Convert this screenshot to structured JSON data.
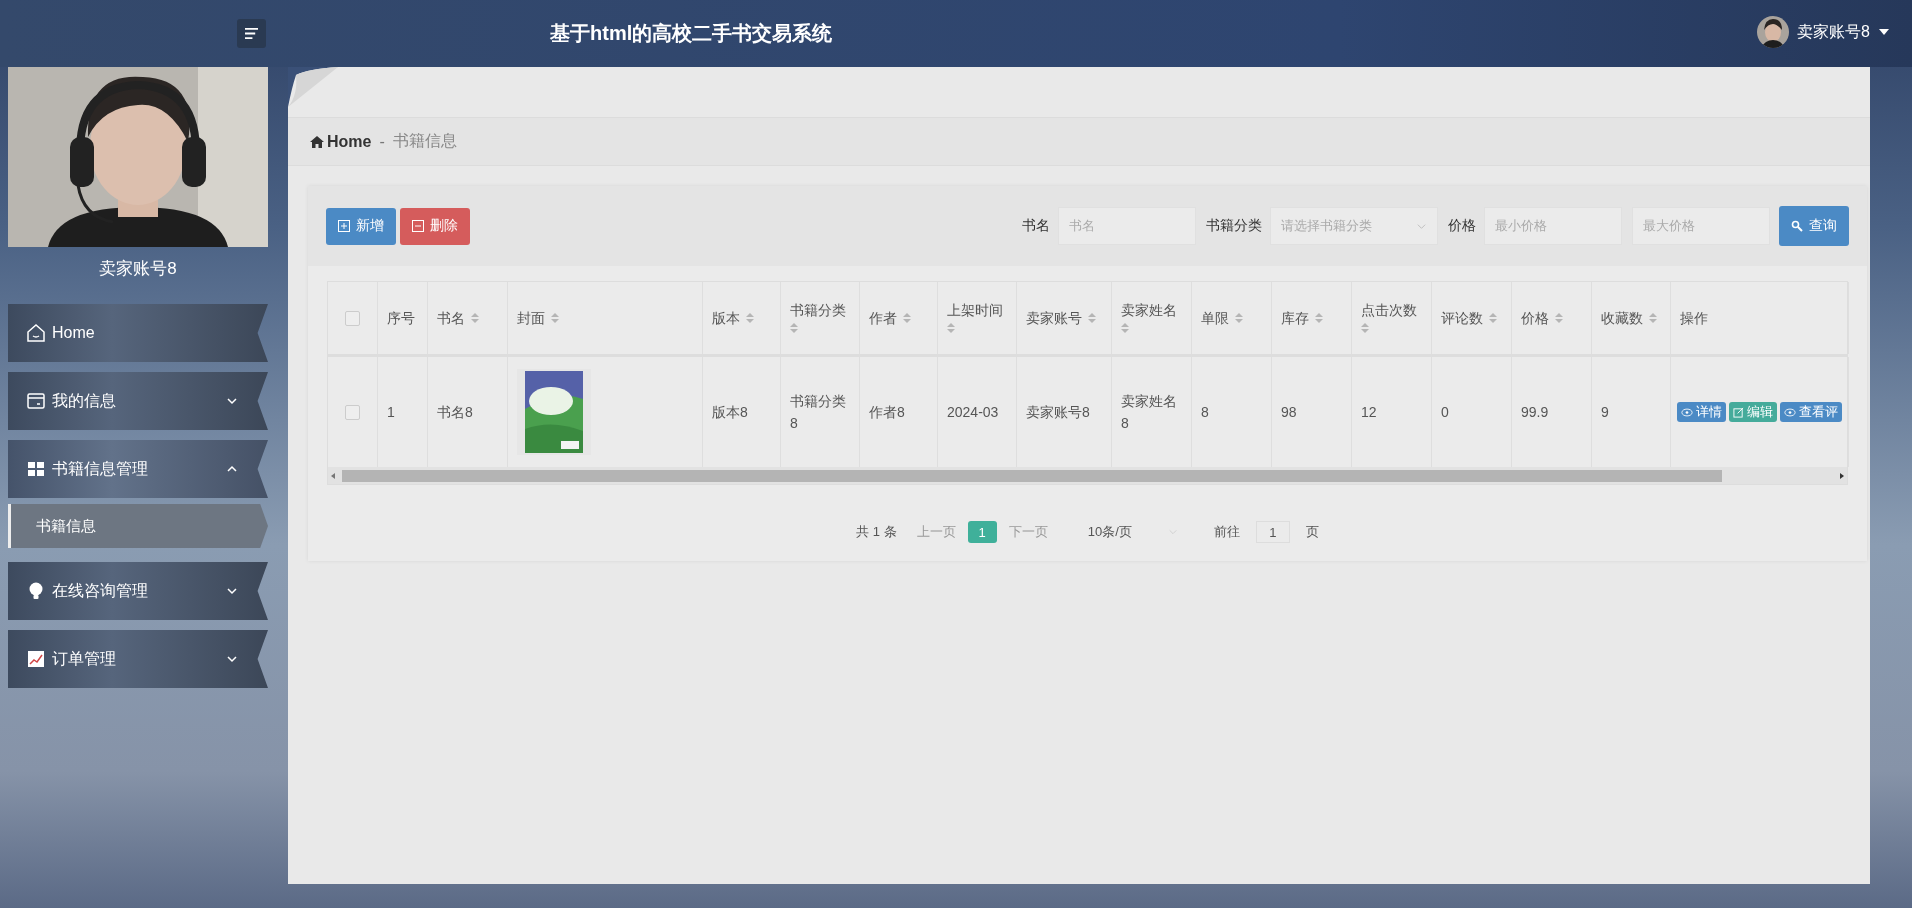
{
  "header": {
    "title": "基于html的高校二手书交易系统",
    "user_name": "卖家账号8"
  },
  "sidebar": {
    "profile_name": "卖家账号8",
    "items": [
      {
        "label": "Home",
        "kind": "link"
      },
      {
        "label": "我的信息",
        "kind": "group",
        "expanded": false
      },
      {
        "label": "书籍信息管理",
        "kind": "group",
        "expanded": true,
        "children": [
          {
            "label": "书籍信息",
            "selected": true
          }
        ]
      },
      {
        "label": "在线咨询管理",
        "kind": "group",
        "expanded": false
      },
      {
        "label": "订单管理",
        "kind": "group",
        "expanded": false
      }
    ]
  },
  "breadcrumb": {
    "home": "Home",
    "separator": "-",
    "current": "书籍信息"
  },
  "toolbar": {
    "buttons": [
      {
        "label": "新增",
        "kind": "add"
      },
      {
        "label": "删除",
        "kind": "delete"
      }
    ],
    "filters": [
      {
        "label": "书名",
        "placeholder": "书名",
        "kind": "input"
      },
      {
        "label": "书籍分类",
        "placeholder": "请选择书籍分类",
        "kind": "select"
      },
      {
        "label": "价格",
        "placeholder": "最小价格",
        "kind": "input"
      },
      {
        "placeholder": "最大价格",
        "kind": "input"
      }
    ],
    "search_button": "查询"
  },
  "table": {
    "header_checked": false,
    "columns": [
      {
        "label": "序号",
        "sortable": false
      },
      {
        "label": "书名",
        "sortable": true
      },
      {
        "label": "封面",
        "sortable": true
      },
      {
        "label": "版本",
        "sortable": true
      },
      {
        "label": "书籍分类",
        "sortable": true
      },
      {
        "label": "作者",
        "sortable": true
      },
      {
        "label": "上架时间",
        "sortable": true
      },
      {
        "label": "卖家账号",
        "sortable": true
      },
      {
        "label": "卖家姓名",
        "sortable": true
      },
      {
        "label": "单限",
        "sortable": true
      },
      {
        "label": "库存",
        "sortable": true
      },
      {
        "label": "点击次数",
        "sortable": true
      },
      {
        "label": "评论数",
        "sortable": true
      },
      {
        "label": "价格",
        "sortable": true
      },
      {
        "label": "收藏数",
        "sortable": true
      },
      {
        "label": "操作",
        "sortable": false
      }
    ],
    "rows": [
      {
        "checked": false,
        "cells": [
          "1",
          "书名8",
          {
            "kind": "picture"
          },
          "版本8",
          "书籍分类8",
          "作者8",
          "2024-03",
          "卖家账号8",
          "卖家姓名8",
          "8",
          "98",
          "12",
          "0",
          "99.9",
          "9"
        ],
        "actions": [
          {
            "label": "详情",
            "kind": "view"
          },
          {
            "label": "编辑",
            "kind": "edit"
          },
          {
            "label": "查看评",
            "kind": "view"
          }
        ]
      }
    ]
  },
  "pagination": {
    "total": "共 1 条",
    "prev": "上一页",
    "pages": [
      {
        "label": "1",
        "selected": true
      }
    ],
    "next": "下一页",
    "page_size": "10条/页",
    "goto_label": "前往",
    "goto_value": "1",
    "page_unit": "页"
  }
}
